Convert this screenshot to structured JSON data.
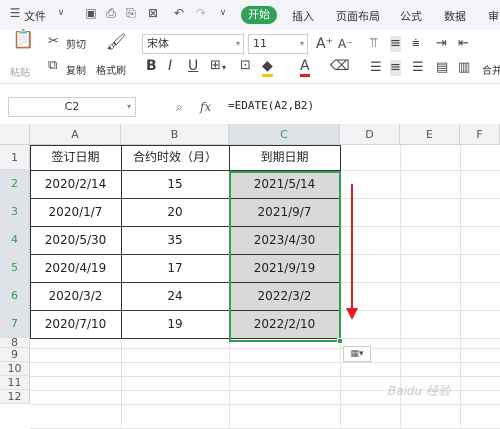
{
  "menu": {
    "file": "文件",
    "start": "开始",
    "insert": "插入",
    "page_layout": "页面布局",
    "formula": "公式",
    "data": "数据",
    "review": "审"
  },
  "toolbar": {
    "cut": "剪切",
    "copy": "复制",
    "format_painter": "格式刷",
    "paste": "粘贴",
    "font_name": "宋体",
    "font_size": "11",
    "merge": "合并"
  },
  "formula_bar": {
    "name_box": "C2",
    "formula": "=EDATE(A2,B2)"
  },
  "sheet": {
    "columns": [
      "A",
      "B",
      "C",
      "D",
      "E",
      "F"
    ],
    "rows": [
      "1",
      "2",
      "3",
      "4",
      "5",
      "6",
      "7",
      "8",
      "9",
      "10",
      "11",
      "12"
    ],
    "headers": [
      "签订日期",
      "合约时效（月）",
      "到期日期"
    ],
    "data": [
      [
        "2020/2/14",
        "15",
        "2021/5/14"
      ],
      [
        "2020/1/7",
        "20",
        "2021/9/7"
      ],
      [
        "2020/5/30",
        "35",
        "2023/4/30"
      ],
      [
        "2020/4/19",
        "17",
        "2021/9/19"
      ],
      [
        "2020/3/2",
        "24",
        "2022/3/2"
      ],
      [
        "2020/7/10",
        "19",
        "2022/2/10"
      ]
    ],
    "active_column": "C",
    "selected_rows": [
      "2",
      "3",
      "4",
      "5",
      "6",
      "7"
    ]
  },
  "colors": {
    "accent": "#2fa055",
    "selection_fill": "#d9d9d9",
    "arrow": "#e02020"
  },
  "watermark": "Baidu 经验"
}
